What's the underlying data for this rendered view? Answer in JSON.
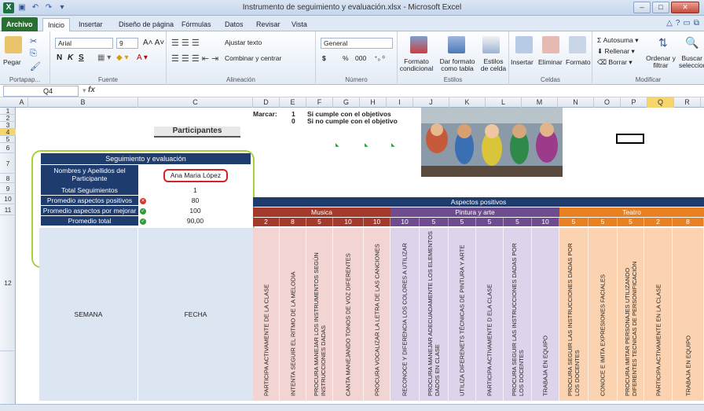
{
  "window": {
    "title": "Instrumento de seguimiento y evaluación.xlsx - Microsoft Excel"
  },
  "tabs": [
    "Archivo",
    "Inicio",
    "Insertar",
    "Diseño de página",
    "Fórmulas",
    "Datos",
    "Revisar",
    "Vista"
  ],
  "ribbon": {
    "clipboard": {
      "paste": "Pegar",
      "label": "Portapap..."
    },
    "font": {
      "name": "Arial",
      "size": "9",
      "bold": "N",
      "italic": "K",
      "underline": "S",
      "label": "Fuente"
    },
    "alignment": {
      "wrap": "Ajustar texto",
      "merge": "Combinar y centrar",
      "label": "Alineación"
    },
    "number": {
      "format": "General",
      "currency": "$",
      "percent": "%",
      "thousands": "000",
      "label": "Número"
    },
    "styles": {
      "conditional": "Formato condicional",
      "table": "Dar formato como tabla",
      "cell": "Estilos de celda",
      "label": "Estilos"
    },
    "cells": {
      "insert": "Insertar",
      "delete": "Eliminar",
      "format": "Formato",
      "label": "Celdas"
    },
    "editing": {
      "autosum": "Autosuma",
      "fill": "Rellenar",
      "clear": "Borrar",
      "sort": "Ordenar y filtrar",
      "find": "Buscar y seleccionar",
      "label": "Modificar"
    }
  },
  "formula_bar": {
    "cell": "Q4",
    "fx": "fx",
    "value": ""
  },
  "columns": [
    "A",
    "B",
    "C",
    "D",
    "E",
    "F",
    "G",
    "H",
    "I",
    "J",
    "K",
    "L",
    "M",
    "N",
    "O",
    "P",
    "Q",
    "R",
    "S"
  ],
  "rows": [
    "1",
    "2",
    "3",
    "4",
    "5",
    "6",
    "7",
    "8",
    "9",
    "10",
    "11",
    "12"
  ],
  "marcar": {
    "label": "Marcar:",
    "v1": "1",
    "t1": "Si cumple con el objetivos",
    "v0": "0",
    "t0": "Si no cumple con el objetivo"
  },
  "participantes": "Participantes",
  "summary": {
    "header": "Seguimiento y evaluación",
    "rows": [
      {
        "label": "Nombres y Apellidos del Participante",
        "value": "Ana Maria López"
      },
      {
        "label": "Total Seguimientos",
        "value": "1"
      },
      {
        "label": "Promedio aspectos positivos",
        "value": "80",
        "status": "bad"
      },
      {
        "label": "Promedio aspectos por mejorar",
        "value": "100",
        "status": "good"
      },
      {
        "label": "Promedio total",
        "value": "90,00",
        "status": "good"
      }
    ]
  },
  "aspectos_positivos": "Aspectos positivos",
  "categories": [
    {
      "name": "Musica",
      "color": "#a33a2c"
    },
    {
      "name": "Pintura y arte",
      "color": "#6f4c8f"
    },
    {
      "name": "Teatro",
      "color": "#e78122"
    }
  ],
  "table_headers": {
    "semana": "SEMANA",
    "fecha": "FECHA"
  },
  "criteria": [
    {
      "text": "PARTICIPA ACTIVAMENTE DE LA CLASE",
      "score": "2",
      "group": "musica"
    },
    {
      "text": "INTENTA SEGUIR EL RITMO DE LA MELODIA",
      "score": "8",
      "group": "musica"
    },
    {
      "text": "PROCURA MANEJAR LOS INSTRUMENTOS SEGÚN INSTRUCCIONES DADAS",
      "score": "5",
      "group": "musica"
    },
    {
      "text": "CANTA MANEJANDO TONOS DE VOZ DIFERENTES",
      "score": "10",
      "group": "musica"
    },
    {
      "text": "PROCURA VOCALIZAR LA LETRA DE LAS CANCIONES",
      "score": "10",
      "group": "musica"
    },
    {
      "text": "RECONOCE Y DIFERENCIA LOS COLORES A UTILIZAR",
      "score": "10",
      "group": "pintura"
    },
    {
      "text": "PROCURA MANEJAR ADECUADAMENTE LOS ELEMENTOS DADOS EN CLASE",
      "score": "5",
      "group": "pintura"
    },
    {
      "text": "UTILIZA DIFERENETS TÉCNICAS DE PINTURA Y ARTE",
      "score": "5",
      "group": "pintura"
    },
    {
      "text": "PARTICIPA ACTIVAMENTE D ELA CLASE",
      "score": "5",
      "group": "pintura"
    },
    {
      "text": "PROCURA SEGUIR LAS INSTRUCCIONES DADAS POR LOS DOCENTES",
      "score": "5",
      "group": "pintura"
    },
    {
      "text": "TRABAJA EN EQUIPO",
      "score": "10",
      "group": "pintura"
    },
    {
      "text": "PROCURA SEGUIR LAS INSTRUCCIONES DADAS POR LOS DOCENTES",
      "score": "5",
      "group": "teatro"
    },
    {
      "text": "CONOCE E IMITA EXPRESIONES FACIALES",
      "score": "5",
      "group": "teatro"
    },
    {
      "text": "PROCURA IMITAR PERSONAJES UTILIZANDO DIFERENTES TECNICAS DE PERSONIFICACIÓN",
      "score": "5",
      "group": "teatro"
    },
    {
      "text": "PARTICIPA ACTIVAMENTE EN LA CLASE",
      "score": "2",
      "group": "teatro"
    },
    {
      "text": "TRABAJA EN EQUIPO",
      "score": "8",
      "group": "teatro"
    }
  ]
}
